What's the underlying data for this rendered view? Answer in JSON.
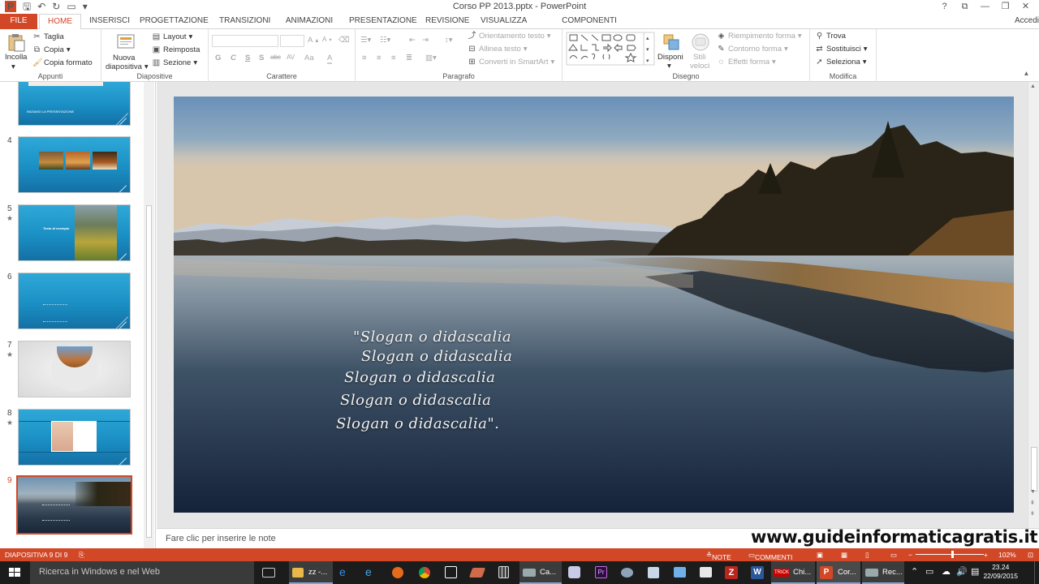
{
  "app": {
    "window_title": "Corso PP 2013.pptx - PowerPoint",
    "window_controls": [
      "?",
      "⧉",
      "—",
      "❐",
      "✕"
    ],
    "account": "Accedi"
  },
  "ribbon_tabs": [
    "FILE",
    "HOME",
    "INSERISCI",
    "PROGETTAZIONE",
    "TRANSIZIONI",
    "ANIMAZIONI",
    "PRESENTAZIONE",
    "REVISIONE",
    "VISUALIZZA",
    "COMPONENTI AGGIUNTIVI"
  ],
  "ribbon": {
    "appunti": {
      "label": "Appunti",
      "paste": "Incolla",
      "cut": "Taglia",
      "copy": "Copia",
      "format_painter": "Copia formato"
    },
    "diapositive": {
      "label": "Diapositive",
      "new_slide_line1": "Nuova",
      "new_slide_line2": "diapositiva",
      "layout": "Layout",
      "reset": "Reimposta",
      "section": "Sezione"
    },
    "carattere": {
      "label": "Carattere",
      "bold": "G",
      "italic": "C",
      "underline": "S",
      "shadow": "S",
      "strike": "abc",
      "spacing": "AV",
      "case": "Aa",
      "grow": "A",
      "shrink": "A"
    },
    "paragrafo": {
      "label": "Paragrafo",
      "text_direction": "Orientamento testo",
      "align_text": "Allinea testo",
      "smartart": "Converti in SmartArt"
    },
    "disegno": {
      "label": "Disegno",
      "arrange": "Disponi",
      "quick_styles_line1": "Stili",
      "quick_styles_line2": "veloci",
      "shape_fill": "Riempimento forma",
      "shape_outline": "Contorno forma",
      "shape_effects": "Effetti forma"
    },
    "modifica": {
      "label": "Modifica",
      "find": "Trova",
      "replace": "Sostituisci",
      "select": "Seleziona"
    }
  },
  "thumbnails": [
    {
      "number": "",
      "caption": "INIZIAMO LA PRESENTAZIONE",
      "star": false
    },
    {
      "number": "4",
      "caption": "",
      "star": false
    },
    {
      "number": "5",
      "caption": "Testo di esempio",
      "star": true
    },
    {
      "number": "6",
      "caption": "",
      "star": false
    },
    {
      "number": "7",
      "caption": "",
      "star": true
    },
    {
      "number": "8",
      "caption": "",
      "star": true
    },
    {
      "number": "9",
      "caption": "",
      "star": false
    }
  ],
  "slide": {
    "lines": [
      "\"Slogan o didascalia",
      "Slogan o didascalia",
      "Slogan o didascalia",
      "Slogan o didascalia",
      "Slogan o didascalia\"."
    ]
  },
  "notes_placeholder": "Fare clic per inserire le note",
  "watermark": "www.guideinformaticagratis.it",
  "statusbar": {
    "slide_info": "DIAPOSITIVA 9 DI 9",
    "notes": "NOTE",
    "comments": "COMMENTI",
    "zoom": "102%",
    "zoom_fraction": 0.53
  },
  "taskbar": {
    "search_placeholder": "Ricerca in Windows e nel Web",
    "items": [
      "zz -...",
      "Ca...",
      "Chi...",
      "Cor...",
      "Rec..."
    ],
    "time": "23.24",
    "date": "22/09/2015"
  },
  "colors": {
    "accent": "#d24726",
    "slide_blue": "#1a8fc4",
    "taskbar": "#1c1c1c"
  }
}
